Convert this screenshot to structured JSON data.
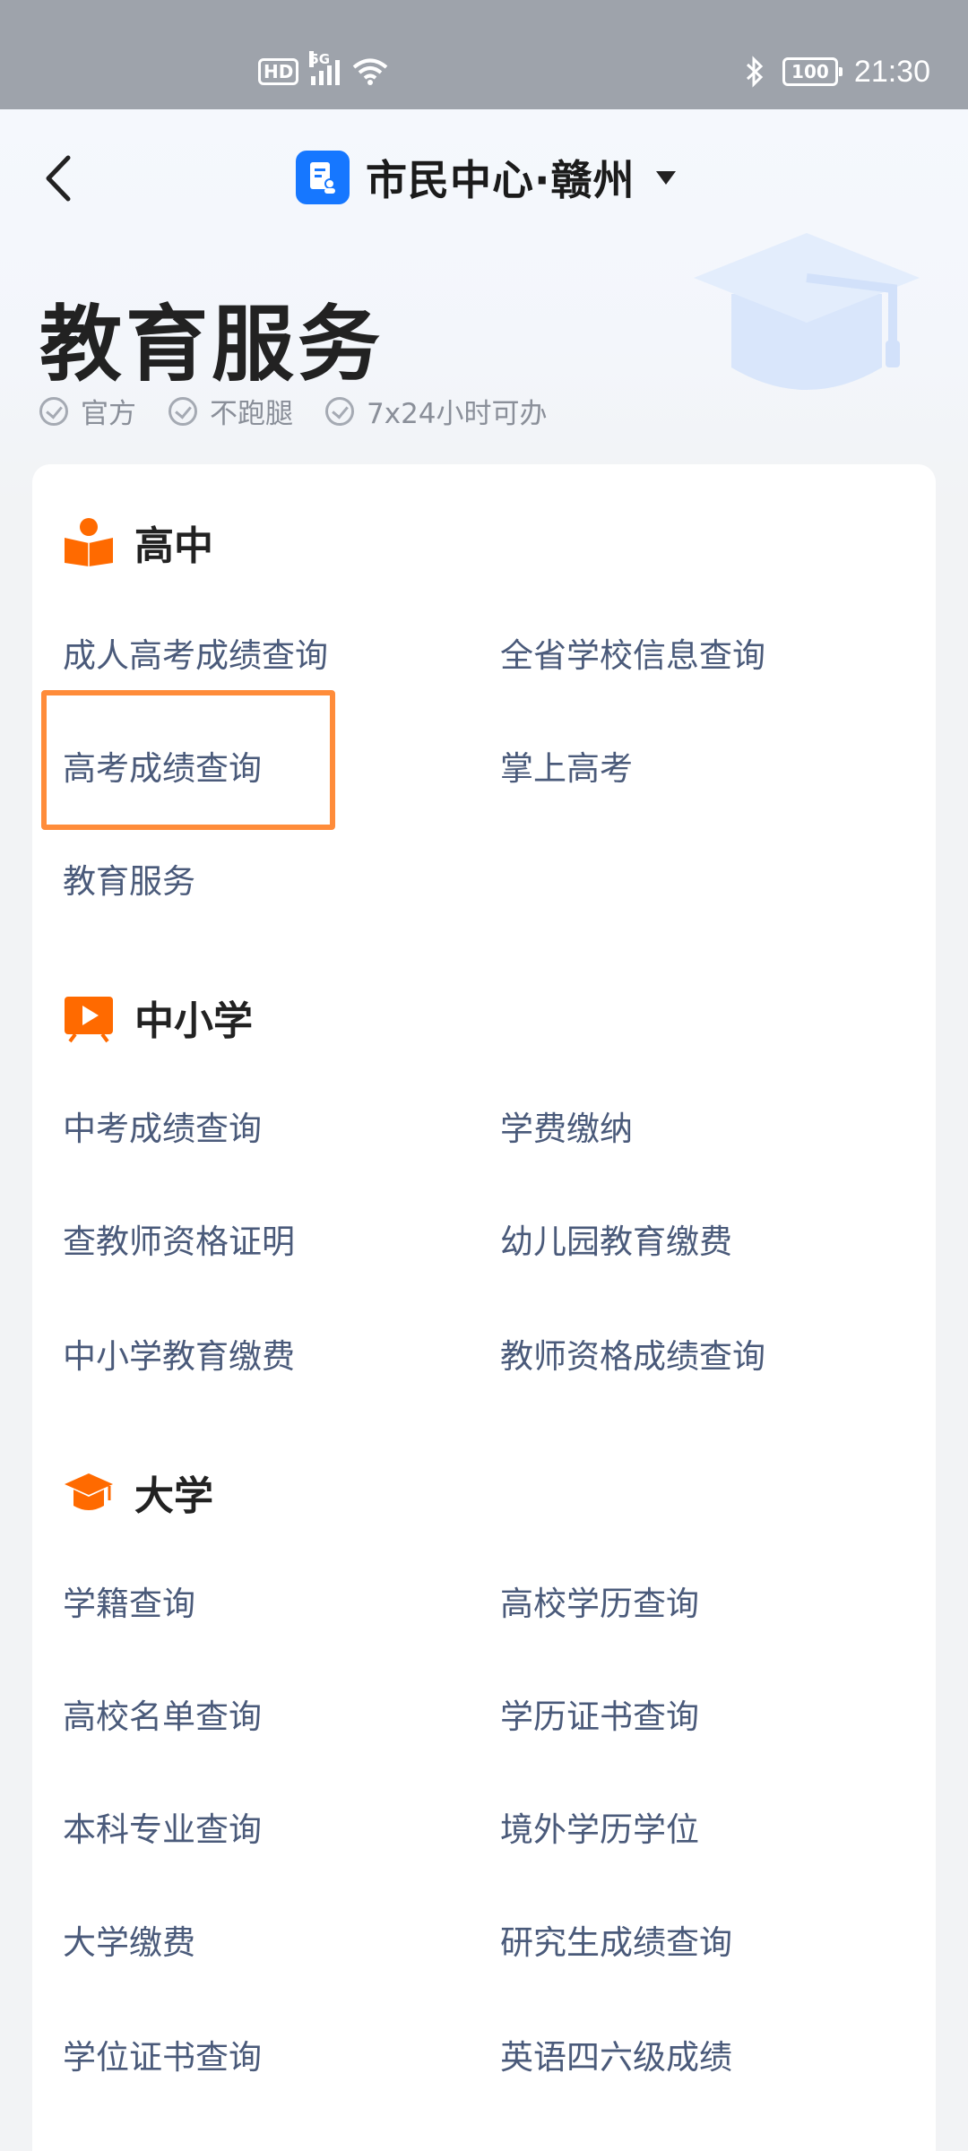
{
  "status_bar": {
    "network_badge": "HD",
    "network_gen": "5G",
    "battery": "100",
    "time": "21:30"
  },
  "nav": {
    "title": "市民中心·赣州"
  },
  "page": {
    "title": "教育服务",
    "badges": [
      "官方",
      "不跑腿",
      "7x24小时可办"
    ]
  },
  "sections": {
    "high_school": {
      "title": "高中",
      "items": [
        "成人高考成绩查询",
        "全省学校信息查询",
        "高考成绩查询",
        "掌上高考",
        "教育服务"
      ]
    },
    "k12": {
      "title": "中小学",
      "items": [
        "中考成绩查询",
        "学费缴纳",
        "查教师资格证明",
        "幼儿园教育缴费",
        "中小学教育缴费",
        "教师资格成绩查询"
      ]
    },
    "university": {
      "title": "大学",
      "items": [
        "学籍查询",
        "高校学历查询",
        "高校名单查询",
        "学历证书查询",
        "本科专业查询",
        "境外学历学位",
        "大学缴费",
        "研究生成绩查询",
        "学位证书查询",
        "英语四六级成绩"
      ]
    }
  },
  "colors": {
    "accent_orange": "#ff6a00",
    "highlight_box": "#ff8c3a",
    "link_text": "#4a5a7a",
    "brand_blue": "#1677ff"
  }
}
